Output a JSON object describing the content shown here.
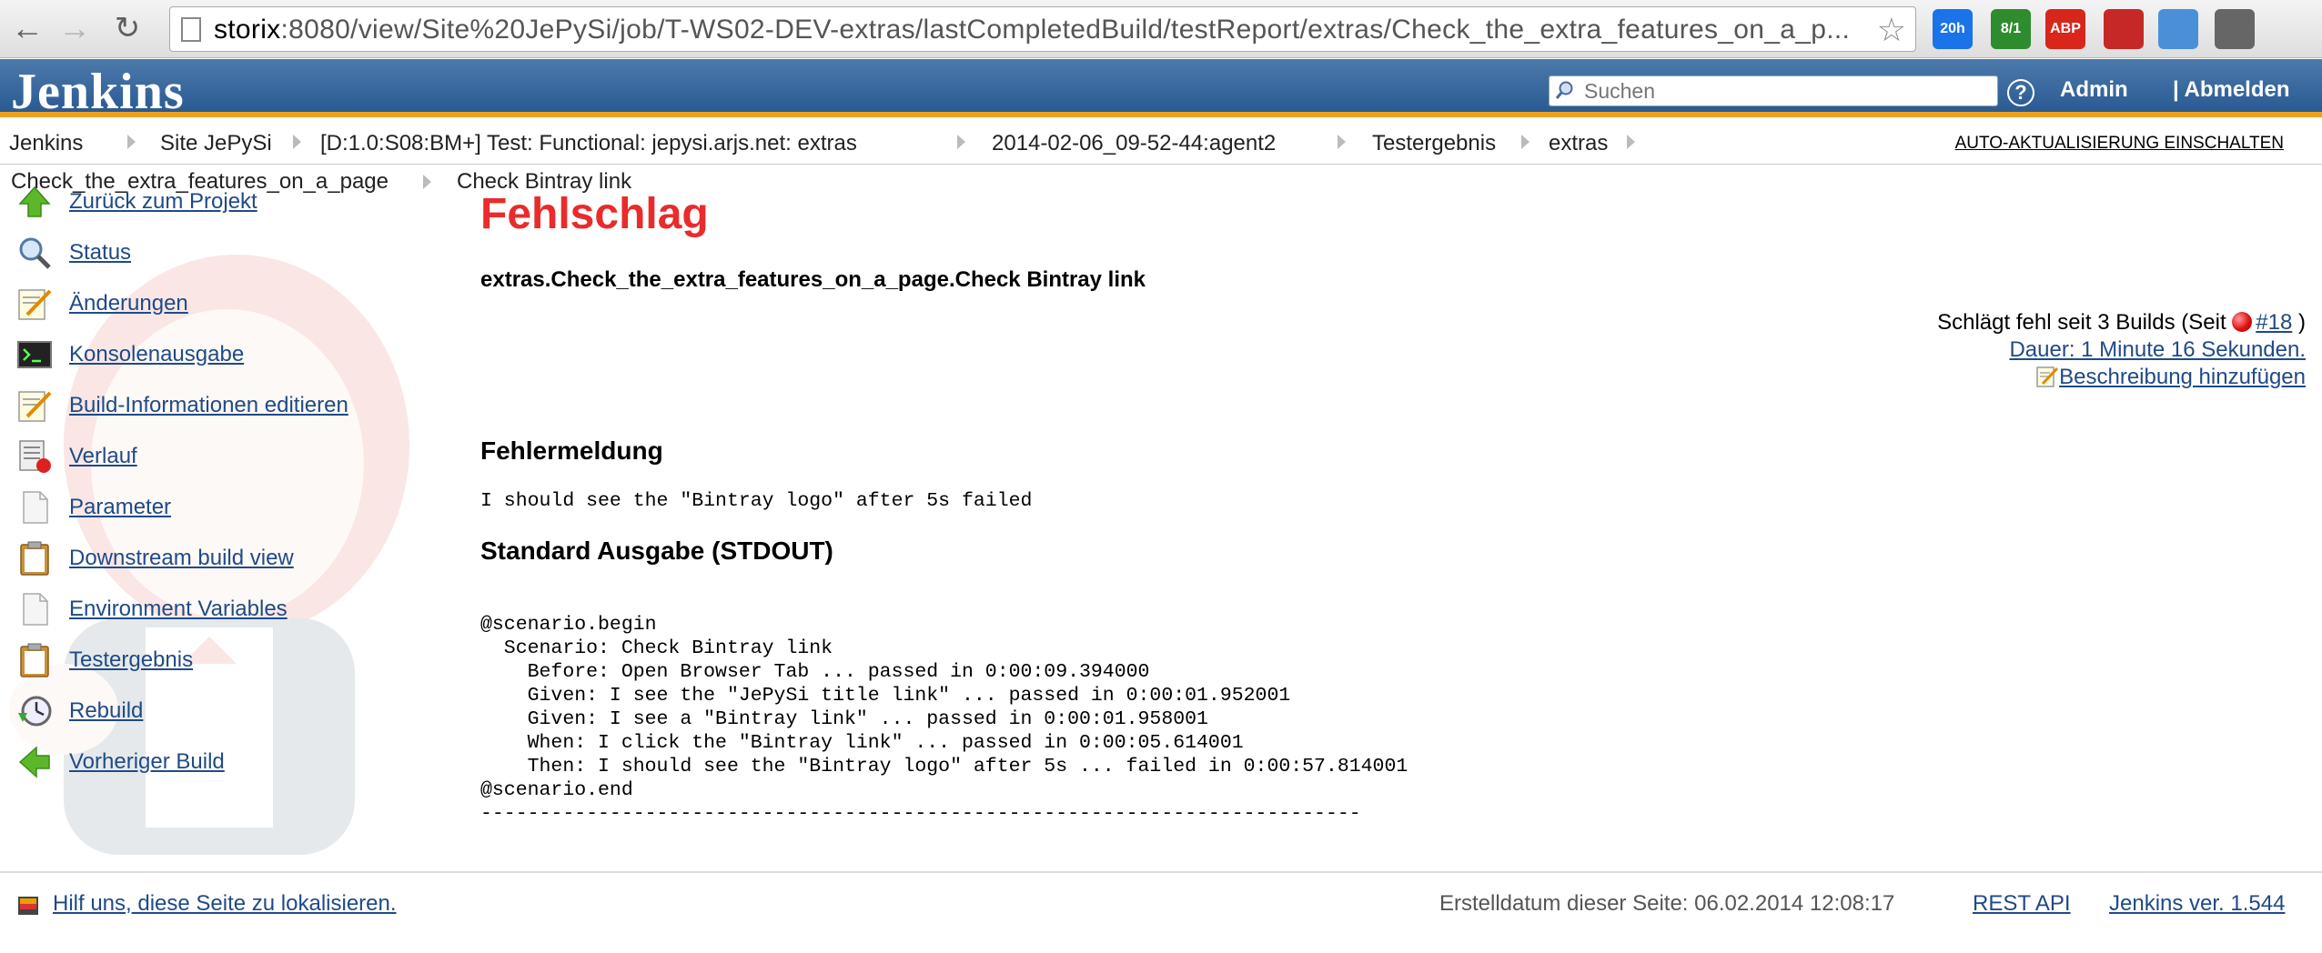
{
  "browser": {
    "url_host": "storix",
    "url_rest": ":8080/view/Site%20JePySi/job/T-WS02-DEV-extras/lastCompletedBuild/testReport/extras/Check_the_extra_features_on_a_p...",
    "extensions": [
      {
        "name": "calendar-badge",
        "badge": "20h",
        "color": "#1a73e8"
      },
      {
        "name": "mail-badge",
        "badge": "8/1",
        "color": "#2e8b2e"
      },
      {
        "name": "adblock",
        "badge": "ABP",
        "color": "#d8261b"
      },
      {
        "name": "bookmark-ext",
        "badge": "",
        "color": "#c62828"
      },
      {
        "name": "folder-ext",
        "badge": "",
        "color": "#4a90d9"
      },
      {
        "name": "round-ext",
        "badge": "",
        "color": "#666666"
      }
    ]
  },
  "header": {
    "logo": "Jenkins",
    "search_placeholder": "Suchen",
    "admin": "Admin",
    "logout": "| Abmelden"
  },
  "breadcrumb": {
    "items": [
      "Jenkins",
      "Site JePySi",
      "[D:1.0:S08:BM+] Test: Functional: jepysi.arjs.net: extras",
      "2014-02-06_09-52-44:agent2",
      "Testergebnis",
      "extras"
    ],
    "second_line": [
      "Check_the_extra_features_on_a_page",
      "Check Bintray link"
    ],
    "auto_refresh": "AUTO-AKTUALISIERUNG EINSCHALTEN"
  },
  "sidebar": {
    "items": [
      {
        "label": "Zurück zum Projekt",
        "icon": "up-arrow-icon"
      },
      {
        "label": "Status",
        "icon": "magnifier-icon"
      },
      {
        "label": "Änderungen",
        "icon": "notepad-icon"
      },
      {
        "label": "Konsolenausgabe",
        "icon": "terminal-icon"
      },
      {
        "label": "Build-Informationen editieren",
        "icon": "notepad-icon"
      },
      {
        "label": "Verlauf",
        "icon": "history-icon"
      },
      {
        "label": "Parameter",
        "icon": "document-icon"
      },
      {
        "label": "Downstream build view",
        "icon": "clipboard-icon"
      },
      {
        "label": "Environment Variables",
        "icon": "document-icon"
      },
      {
        "label": "Testergebnis",
        "icon": "clipboard-icon"
      },
      {
        "label": "Rebuild",
        "icon": "clock-icon"
      },
      {
        "label": "Vorheriger Build",
        "icon": "left-arrow-icon"
      }
    ]
  },
  "main": {
    "status_title": "Fehlschlag",
    "test_name": "extras.Check_the_extra_features_on_a_page.Check Bintray link",
    "failing_since_prefix": "Schlägt fehl seit 3 Builds (Seit",
    "failing_since_build": "#18",
    "failing_since_suffix": ")",
    "duration": "Dauer: 1 Minute 16 Sekunden.",
    "add_description": "Beschreibung hinzufügen",
    "error_heading": "Fehlermeldung",
    "error_message": "I should see the \"Bintray logo\" after 5s failed",
    "stdout_heading": "Standard Ausgabe (STDOUT)",
    "stdout_lines": [
      "@scenario.begin",
      "  Scenario: Check Bintray link",
      "    Before: Open Browser Tab ... passed in 0:00:09.394000",
      "    Given: I see the \"JePySi title link\" ... passed in 0:00:01.952001",
      "    Given: I see a \"Bintray link\" ... passed in 0:00:01.958001",
      "    When: I click the \"Bintray link\" ... passed in 0:00:05.614001",
      "    Then: I should see the \"Bintray logo\" after 5s ... failed in 0:00:57.814001",
      "@scenario.end",
      "---------------------------------------------------------------------------"
    ]
  },
  "footer": {
    "localize": "Hilf uns, diese Seite zu lokalisieren.",
    "created": "Erstelldatum dieser Seite: 06.02.2014 12:08:17",
    "rest_api": "REST API",
    "version": "Jenkins ver. 1.544"
  }
}
